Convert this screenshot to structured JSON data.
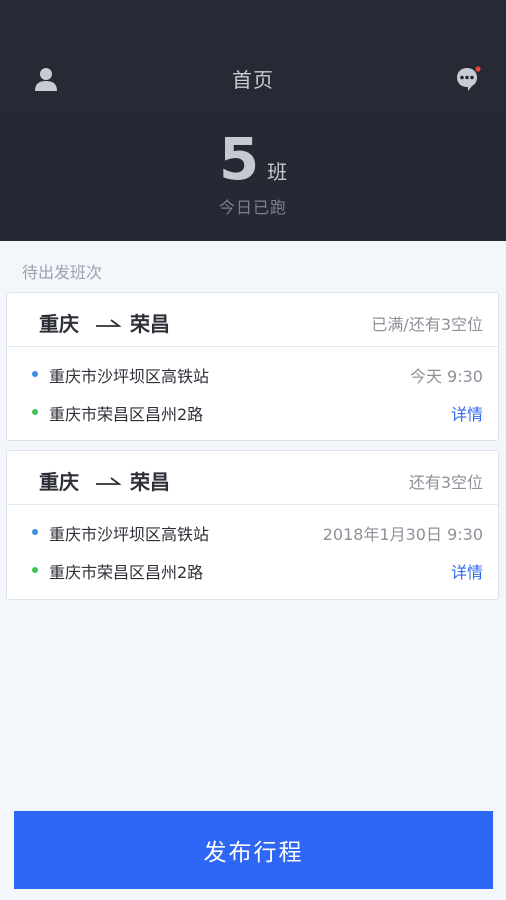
{
  "nav": {
    "title": "首页",
    "left_icon": "user-icon",
    "right_icon": "message-icon",
    "badge_color": "#e8433a"
  },
  "summary": {
    "count": "5",
    "unit": "班",
    "label": "今日已跑"
  },
  "section_title": "待出发班次",
  "trips": [
    {
      "from": "重庆",
      "to": "荣昌",
      "status": "已满/还有3空位",
      "origin_stop": "重庆市沙坪坝区高铁站",
      "time": "今天 9:30",
      "destination_stop": "重庆市荣昌区昌州2路",
      "detail_label": "详情"
    },
    {
      "from": "重庆",
      "to": "荣昌",
      "status": "还有3空位",
      "origin_stop": "重庆市沙坪坝区高铁站",
      "time": "2018年1月30日 9:30",
      "destination_stop": "重庆市荣昌区昌州2路",
      "detail_label": "详情"
    }
  ],
  "publish_button": "发布行程",
  "colors": {
    "header_bg": "#262834",
    "accent": "#2e66f6",
    "link": "#2f6af2",
    "origin_dot": "#3a8ee6",
    "destination_dot": "#3fc54e"
  }
}
